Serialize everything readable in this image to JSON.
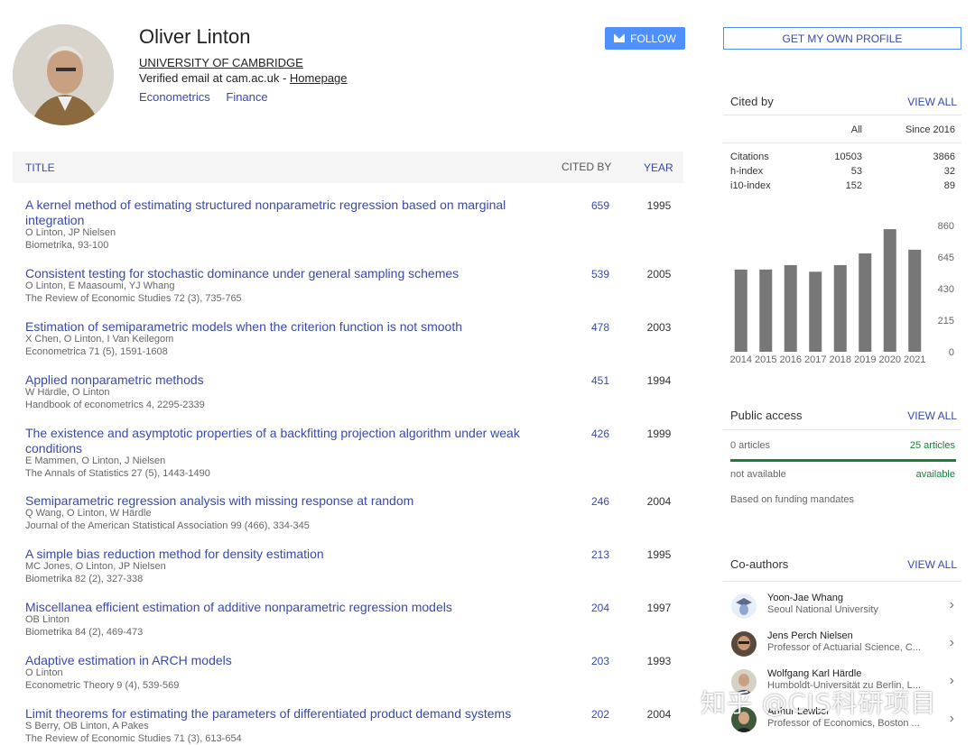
{
  "profile": {
    "name": "Oliver Linton",
    "affiliation": "UNIVERSITY OF CAMBRIDGE",
    "email_text": "Verified email at cam.ac.uk - ",
    "homepage_label": "Homepage",
    "interests": [
      "Econometrics",
      "Finance"
    ],
    "follow_label": "FOLLOW"
  },
  "table": {
    "headers": {
      "title": "TITLE",
      "cited_by": "CITED BY",
      "year": "YEAR"
    },
    "rows": [
      {
        "title": "A kernel method of estimating structured nonparametric regression based on marginal integration",
        "authors": "O Linton, JP Nielsen",
        "venue": "Biometrika, 93-100",
        "cited": "659",
        "year": "1995"
      },
      {
        "title": "Consistent testing for stochastic dominance under general sampling schemes",
        "authors": "O Linton, E Maasoumi, YJ Whang",
        "venue": "The Review of Economic Studies 72 (3), 735-765",
        "cited": "539",
        "year": "2005"
      },
      {
        "title": "Estimation of semiparametric models when the criterion function is not smooth",
        "authors": "X Chen, O Linton, I Van Keilegom",
        "venue": "Econometrica 71 (5), 1591-1608",
        "cited": "478",
        "year": "2003"
      },
      {
        "title": "Applied nonparametric methods",
        "authors": "W Härdle, O Linton",
        "venue": "Handbook of econometrics 4, 2295-2339",
        "cited": "451",
        "year": "1994"
      },
      {
        "title": "The existence and asymptotic properties of a backfitting projection algorithm under weak conditions",
        "authors": "E Mammen, O Linton, J Nielsen",
        "venue": "The Annals of Statistics 27 (5), 1443-1490",
        "cited": "426",
        "year": "1999"
      },
      {
        "title": "Semiparametric regression analysis with missing response at random",
        "authors": "Q Wang, O Linton, W Härdle",
        "venue": "Journal of the American Statistical Association 99 (466), 334-345",
        "cited": "246",
        "year": "2004"
      },
      {
        "title": "A simple bias reduction method for density estimation",
        "authors": "MC Jones, O Linton, JP Nielsen",
        "venue": "Biometrika 82 (2), 327-338",
        "cited": "213",
        "year": "1995"
      },
      {
        "title": "Miscellanea efficient estimation of additive nonparametric regression models",
        "authors": "OB Linton",
        "venue": "Biometrika 84 (2), 469-473",
        "cited": "204",
        "year": "1997"
      },
      {
        "title": "Adaptive estimation in ARCH models",
        "authors": "O Linton",
        "venue": "Econometric Theory 9 (4), 539-569",
        "cited": "203",
        "year": "1993"
      },
      {
        "title": "Limit theorems for estimating the parameters of differentiated product demand systems",
        "authors": "S Berry, OB Linton, A Pakes",
        "venue": "The Review of Economic Studies 71 (3), 613-654",
        "cited": "202",
        "year": "2004"
      }
    ]
  },
  "sidebar": {
    "own_profile_label": "GET MY OWN PROFILE",
    "cited_by": {
      "title": "Cited by",
      "view_all": "VIEW ALL",
      "col_all": "All",
      "col_since": "Since 2016",
      "rows": [
        {
          "label": "Citations",
          "all": "10503",
          "since": "3866"
        },
        {
          "label": "h-index",
          "all": "53",
          "since": "32"
        },
        {
          "label": "i10-index",
          "all": "152",
          "since": "89"
        }
      ]
    },
    "public_access": {
      "title": "Public access",
      "view_all": "VIEW ALL",
      "left_count": "0 articles",
      "right_count": "25 articles",
      "left_status": "not available",
      "right_status": "available",
      "note": "Based on funding mandates"
    },
    "coauthors": {
      "title": "Co-authors",
      "view_all": "VIEW ALL",
      "items": [
        {
          "name": "Yoon-Jae Whang",
          "affiliation": "Seoul National University"
        },
        {
          "name": "Jens Perch Nielsen",
          "affiliation": "Professor of Actuarial Science, C..."
        },
        {
          "name": "Wolfgang Karl Härdle",
          "affiliation": "Humboldt-Universität zu Berlin, L..."
        },
        {
          "name": "Arthur Lewbel",
          "affiliation": "Professor of Economics, Boston ..."
        }
      ]
    }
  },
  "chart_data": {
    "type": "bar",
    "categories": [
      "2014",
      "2015",
      "2016",
      "2017",
      "2018",
      "2019",
      "2020",
      "2021"
    ],
    "values": [
      560,
      560,
      590,
      545,
      590,
      670,
      835,
      695
    ],
    "y_ticks": [
      "860",
      "645",
      "430",
      "215",
      "0"
    ],
    "ylim": [
      0,
      860
    ],
    "bar_color": "#777777",
    "grid": false,
    "legend": "none"
  },
  "watermark": "知乎 @CIS科研项目",
  "colors": {
    "link": "#3949ab",
    "button": "#4d90fe",
    "available": "#188038"
  }
}
